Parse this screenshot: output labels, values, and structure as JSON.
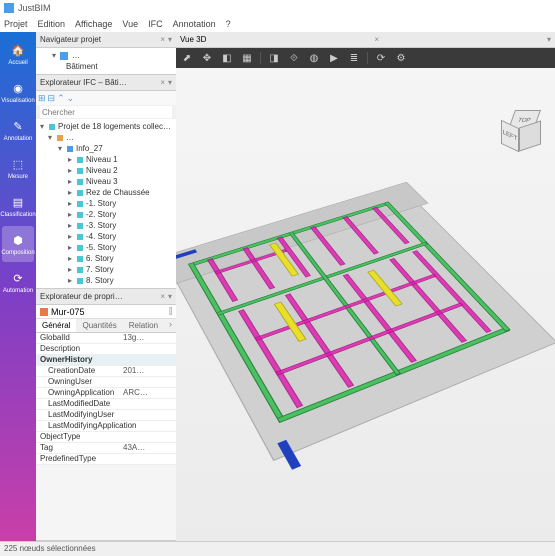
{
  "app": {
    "title": "JustBIM"
  },
  "menu": [
    "Projet",
    "Edition",
    "Affichage",
    "Vue",
    "IFC",
    "Annotation",
    "?"
  ],
  "sidebar": {
    "items": [
      {
        "label": "Accueil",
        "icon": "🏠"
      },
      {
        "label": "Visualisation",
        "icon": "◉"
      },
      {
        "label": "Annotation",
        "icon": "✎"
      },
      {
        "label": "Mesure",
        "icon": "⬚"
      },
      {
        "label": "Classification",
        "icon": "▤"
      },
      {
        "label": "Composition",
        "icon": "⬢"
      },
      {
        "label": "Automation",
        "icon": "⟳"
      }
    ],
    "active": 5
  },
  "navigator": {
    "title": "Navigateur projet",
    "root": "Bâtiment"
  },
  "explorer": {
    "title": "Explorateur IFC – Bâti…",
    "search_placeholder": "Chercher",
    "root": "Projet de 18 logements collec…",
    "info": "Info_27",
    "levels": [
      "Niveau 1",
      "Niveau 2",
      "Niveau 3",
      "Rez de Chaussée",
      "-1. Story",
      "-2. Story",
      "-3. Story",
      "-4. Story",
      "-5. Story",
      "6. Story",
      "7. Story",
      "8. Story"
    ]
  },
  "properties": {
    "title": "Explorateur de propri…",
    "object": "Mur-075",
    "tabs": [
      "Général",
      "Quantités",
      "Relation"
    ],
    "active_tab": 0,
    "rows": [
      {
        "k": "GlobalId",
        "v": "13g…",
        "t": "row"
      },
      {
        "k": "Description",
        "v": "",
        "t": "row"
      },
      {
        "k": "OwnerHistory",
        "v": "",
        "t": "group"
      },
      {
        "k": "CreationDate",
        "v": "201…",
        "t": "sub"
      },
      {
        "k": "OwningUser",
        "v": "",
        "t": "sub"
      },
      {
        "k": "OwningApplication",
        "v": "ARC…",
        "t": "sub"
      },
      {
        "k": "LastModifiedDate",
        "v": "",
        "t": "sub"
      },
      {
        "k": "LastModifyingUser",
        "v": "",
        "t": "sub"
      },
      {
        "k": "LastModifyingApplication",
        "v": "",
        "t": "sub"
      },
      {
        "k": "ObjectType",
        "v": "",
        "t": "row"
      },
      {
        "k": "Tag",
        "v": "43A…",
        "t": "row"
      },
      {
        "k": "PredefinedType",
        "v": "",
        "t": "row"
      }
    ]
  },
  "view3d": {
    "title": "Vue 3D",
    "cube": {
      "top": "TOP",
      "left": "LEFT"
    }
  },
  "statusbar": "225 nœuds sélectionnées"
}
